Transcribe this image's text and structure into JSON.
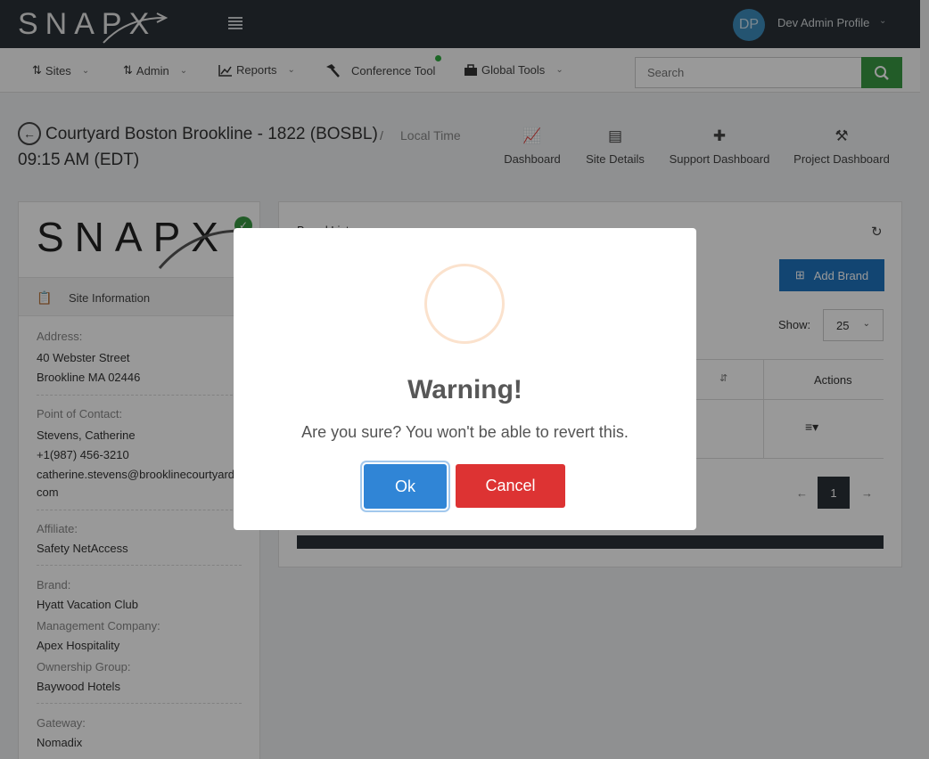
{
  "topbar": {
    "logo": "SNAPX",
    "avatar_initials": "DP",
    "profile_name": "Dev Admin Profile"
  },
  "nav": {
    "items": [
      {
        "label": "Sites",
        "icon": "sites-icon"
      },
      {
        "label": "Admin",
        "icon": "admin-icon"
      },
      {
        "label": "Reports",
        "icon": "chart-icon"
      },
      {
        "label": "Conference Tool",
        "icon": "hammer-icon"
      },
      {
        "label": "Global Tools",
        "icon": "briefcase-icon"
      }
    ],
    "search_placeholder": "Search"
  },
  "header": {
    "site_title": "Courtyard Boston Brookline - 1822 (BOSBL)",
    "separator": "/",
    "local_time_label": "Local Time",
    "local_time": "09:15 AM (EDT)",
    "links": [
      {
        "label": "Dashboard",
        "icon": "line-chart-icon"
      },
      {
        "label": "Site Details",
        "icon": "document-icon"
      },
      {
        "label": "Support Dashboard",
        "icon": "medkit-icon"
      },
      {
        "label": "Project Dashboard",
        "icon": "hammer-icon"
      }
    ]
  },
  "left_card": {
    "logo": "SNAPX",
    "section_title": "Site Information",
    "address_label": "Address:",
    "address_line1": "40 Webster Street",
    "address_line2": "Brookline MA 02446",
    "contact_label": "Point of Contact:",
    "contact_name": "Stevens, Catherine",
    "contact_phone": "+1(987) 456-3210",
    "contact_email_1": "catherine.stevens@brooklinecourtyard.",
    "contact_email_2": "com",
    "affiliate_label": "Affiliate:",
    "affiliate": "Safety NetAccess",
    "brand_label": "Brand:",
    "brand": "Hyatt Vacation Club",
    "mgmt_label": "Management Company:",
    "mgmt": "Apex Hospitality",
    "ownership_label": "Ownership Group:",
    "ownership": "Baywood Hotels",
    "gateway_label": "Gateway:",
    "gateway": "Nomadix"
  },
  "right_card": {
    "title": "Brand List",
    "add_brand_label": "Add Brand",
    "show_label": "Show:",
    "show_value": "25",
    "actions_header": "Actions",
    "pagination": {
      "prev": "←",
      "current": "1",
      "next": "→"
    }
  },
  "modal": {
    "title": "Warning!",
    "text": "Are you sure? You won't be able to revert this.",
    "ok_label": "Ok",
    "cancel_label": "Cancel"
  },
  "colors": {
    "accent": "#3085d6",
    "danger": "#dd3333",
    "success": "#3a9a43",
    "topbar": "#2a3138"
  }
}
